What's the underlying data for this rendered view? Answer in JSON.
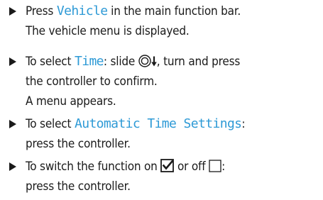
{
  "steps": [
    {
      "line1_pre": "Press ",
      "line1_kw": "Vehicle",
      "line1_post": " in the main function bar.",
      "line2": "The vehicle menu is displayed."
    },
    {
      "line1_pre": "To select ",
      "line1_kw": "Time",
      "line1_mid": ": slide ",
      "line1_post": ", turn and press",
      "line2": "the controller to confirm.",
      "line3": "A menu appears."
    },
    {
      "line1_pre": "To select ",
      "line1_kw": "Automatic Time Settings",
      "line1_post": ":",
      "line2": "press the controller."
    },
    {
      "line1_pre": "To switch the function on ",
      "line1_mid": " or off ",
      "line1_post": ":",
      "line2": "press the controller."
    }
  ],
  "icons": {
    "bullet": "triangle-right-icon",
    "controller": "controller-slide-down-icon",
    "checkbox_on": "checkbox-checked-icon",
    "checkbox_off": "checkbox-empty-icon"
  },
  "colors": {
    "keyword": "#2e9ad6",
    "text": "#1a1a1a"
  }
}
